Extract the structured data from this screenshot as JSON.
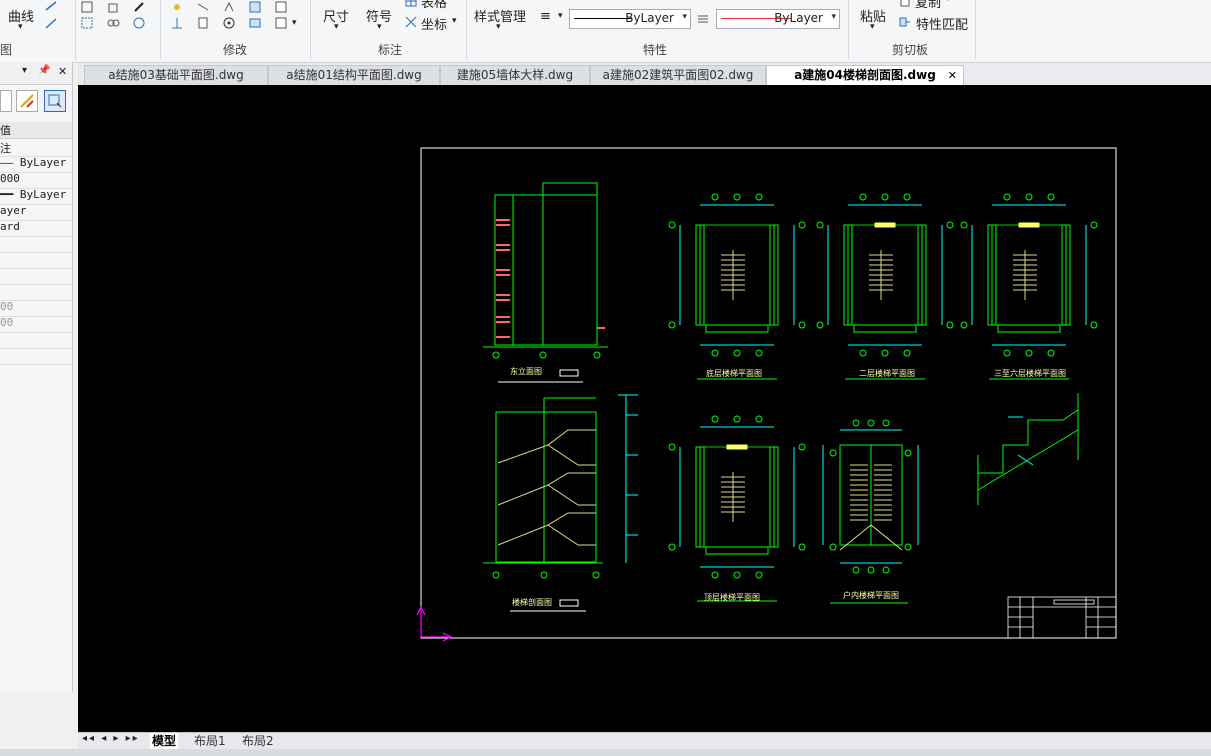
{
  "ribbon": {
    "curve_label": "曲线",
    "dimension_label": "尺寸",
    "symbol_label": "符号",
    "table_label": "表格",
    "coord_label": "坐标",
    "style_mgr_label": "样式管理",
    "paste_label": "粘贴",
    "copy_label": "复制",
    "match_label": "特性匹配",
    "linetype_value": "ByLayer",
    "color_value": "ByLayer",
    "groups": {
      "draw_partial": "图",
      "modify": "修改",
      "annotate": "标注",
      "properties": "特性",
      "clipboard": "剪切板"
    }
  },
  "doc_tabs": [
    {
      "label": "a结施03基础平面图.dwg",
      "active": false
    },
    {
      "label": "a结施01结构平面图.dwg",
      "active": false
    },
    {
      "label": "建施05墙体大样.dwg",
      "active": false
    },
    {
      "label": "a建施02建筑平面图02.dwg",
      "active": false
    },
    {
      "label": "a建施04楼梯剖面图.dwg",
      "active": true
    }
  ],
  "tab_close": "✕",
  "panel": {
    "header_label": "值",
    "rows": [
      "注",
      "—— ByLayer",
      "000",
      "━━ ByLayer",
      "ayer",
      "ard",
      "",
      "",
      "",
      "",
      "00",
      "00",
      "",
      ""
    ]
  },
  "drawing": {
    "labels": {
      "east_elevation": "东立面图",
      "ground_plan": "底层楼梯平面图",
      "second_plan": "二层楼梯平面图",
      "third_plan": "三至六层楼梯平面图",
      "section": "楼梯剖面图",
      "top_plan": "顶层楼梯平面图",
      "outdoor_plan": "户内楼梯平面图"
    }
  },
  "layout_tabs": [
    {
      "label": "模型",
      "active": true
    },
    {
      "label": "布局1",
      "active": false
    },
    {
      "label": "布局2",
      "active": false
    }
  ],
  "nav_arrows": "◂◂ ◂ ▸ ▸▸",
  "colors": {
    "canvas_bg": "#000000",
    "cad_green": "#00ff00",
    "cad_cyan": "#00ffff",
    "cad_yellow": "#ffff66",
    "cad_red": "#ff6666",
    "cad_magenta": "#ff00ff"
  }
}
